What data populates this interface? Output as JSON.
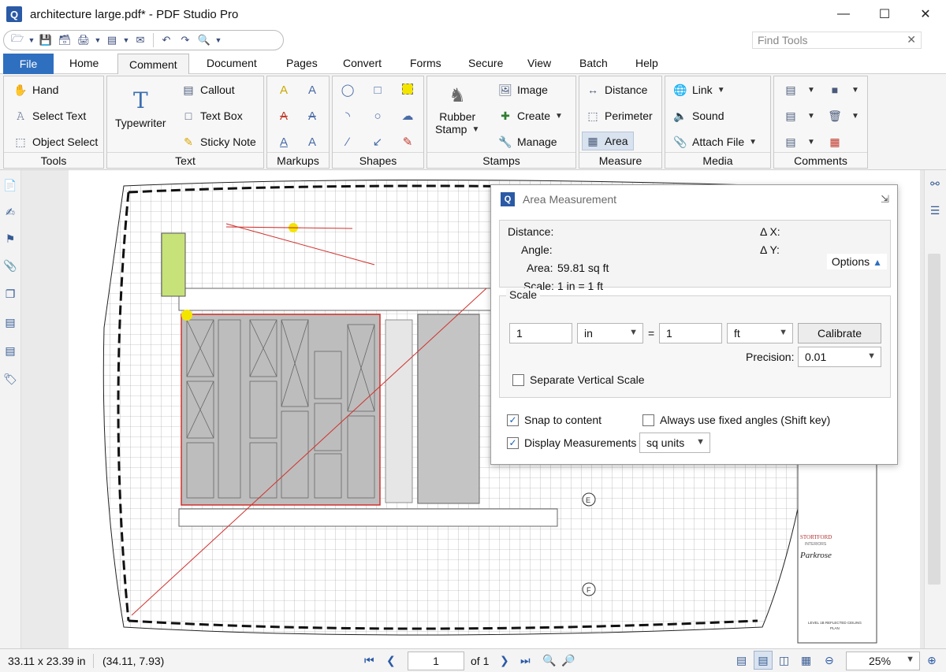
{
  "window": {
    "title": "architecture large.pdf* - PDF Studio Pro",
    "app_icon": "Q",
    "controls": [
      "minimize",
      "maximize",
      "close"
    ]
  },
  "quick_access": {
    "find_tools_placeholder": "Find Tools"
  },
  "tabs": [
    "File",
    "Home",
    "Comment",
    "Document",
    "Pages",
    "Convert",
    "Forms",
    "Secure",
    "View",
    "Batch",
    "Help"
  ],
  "active_tab": "Comment",
  "ribbon": {
    "tools": {
      "label": "Tools",
      "hand": "Hand",
      "select_text": "Select Text",
      "object_select": "Object Select"
    },
    "text": {
      "label": "Text",
      "typewriter": "Typewriter",
      "callout": "Callout",
      "text_box": "Text Box",
      "sticky_note": "Sticky Note"
    },
    "markups": {
      "label": "Markups"
    },
    "shapes": {
      "label": "Shapes"
    },
    "stamps": {
      "label": "Stamps",
      "rubber_stamp_line1": "Rubber",
      "rubber_stamp_line2": "Stamp",
      "image": "Image",
      "create": "Create",
      "manage": "Manage"
    },
    "measure": {
      "label": "Measure",
      "distance": "Distance",
      "perimeter": "Perimeter",
      "area": "Area"
    },
    "media": {
      "label": "Media",
      "link": "Link",
      "sound": "Sound",
      "attach_file": "Attach File"
    },
    "comments": {
      "label": "Comments"
    }
  },
  "dialog": {
    "title": "Area Measurement",
    "readout": {
      "distance_label": "Distance:",
      "angle_label": "Angle:",
      "area_label": "Area:",
      "area_value": "59.81 sq ft",
      "scale_label": "Scale:",
      "scale_value": "1 in = 1 ft",
      "dx_label": "Δ X:",
      "dy_label": "Δ Y:"
    },
    "options_label": "Options",
    "scale": {
      "legend": "Scale",
      "from_value": "1",
      "from_unit": "in",
      "equals": "=",
      "to_value": "1",
      "to_unit": "ft",
      "calibrate": "Calibrate",
      "precision_label": "Precision:",
      "precision_value": "0.01",
      "separate_vertical": "Separate Vertical Scale"
    },
    "snap_to_content": "Snap to content",
    "fixed_angles": "Always use fixed angles (Shift key)",
    "display_measurements": "Display Measurements",
    "display_units": "sq units"
  },
  "drawing": {
    "title_block": {
      "company": "STORTFORD",
      "sub": "INTERIORS",
      "project": "Parkrose",
      "sheet_title_1": "LEVEL 1B REFLECTED CEILING",
      "sheet_title_2": "PLAN"
    },
    "grid_markers": [
      "E",
      "F"
    ]
  },
  "status": {
    "page_size": "33.11 x 23.39 in",
    "cursor": "(34.11, 7.93)",
    "current_page": "1",
    "page_count": "of 1",
    "zoom": "25%"
  },
  "colors": {
    "accent": "#2f6fc0",
    "measure_red": "#d0312d",
    "highlight_green": "#c8e27a"
  }
}
